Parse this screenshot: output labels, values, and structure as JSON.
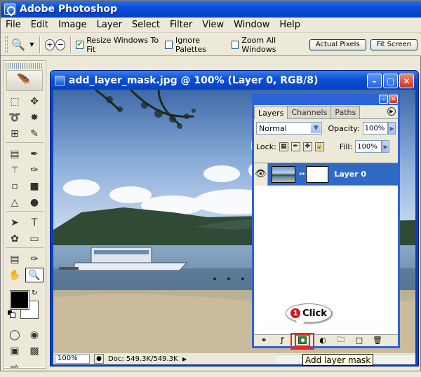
{
  "app": {
    "title": "Adobe Photoshop"
  },
  "menu": [
    "File",
    "Edit",
    "Image",
    "Layer",
    "Select",
    "Filter",
    "View",
    "Window",
    "Help"
  ],
  "options": {
    "resize_windows": {
      "label": "Resize Windows To Fit",
      "checked": true
    },
    "ignore_palettes": {
      "label": "Ignore Palettes",
      "checked": false
    },
    "zoom_all": {
      "label": "Zoom All Windows",
      "checked": false
    },
    "actual_pixels": "Actual Pixels",
    "fit_screen": "Fit Screen"
  },
  "document": {
    "title": "add_layer_mask.jpg @ 100% (Layer 0, RGB/8)",
    "zoom": "100%",
    "doc_info": "Doc: 549.3K/549.3K"
  },
  "layers_panel": {
    "tabs": [
      "Layers",
      "Channels",
      "Paths"
    ],
    "blend_mode": "Normal",
    "opacity_label": "Opacity:",
    "opacity": "100%",
    "lock_label": "Lock:",
    "fill_label": "Fill:",
    "fill": "100%",
    "layers": [
      {
        "name": "Layer 0",
        "visible": true,
        "selected": true
      }
    ]
  },
  "callout": {
    "number": "1",
    "text": "Click"
  },
  "tooltip": "Add layer mask",
  "colors": {
    "selection": "#316ac5",
    "titlebar": "#0a4fd6",
    "highlight": "#ee2222"
  }
}
